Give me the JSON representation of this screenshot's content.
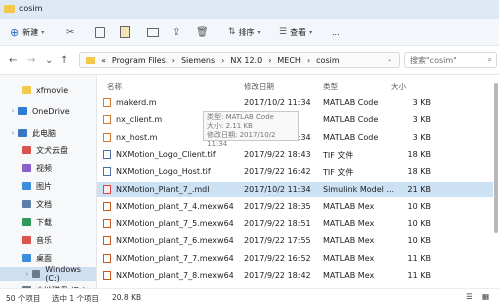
{
  "window": {
    "title": "cosim"
  },
  "toolbar": {
    "new_label": "新建",
    "sort_label": "排序",
    "view_label": "查看",
    "more": "..."
  },
  "address": {
    "back": "←",
    "forward": "→",
    "up": "↑",
    "refresh": "↻",
    "prefix": "«",
    "crumbs": [
      "Program Files",
      "Siemens",
      "NX 12.0",
      "MECH",
      "cosim"
    ],
    "sep": "›"
  },
  "search": {
    "placeholder": "搜索\"cosim\""
  },
  "sidebar": {
    "items": [
      {
        "label": "xfmovie",
        "color": "#f2c94c"
      },
      {
        "label": "OneDrive",
        "color": "#2d7cd6"
      },
      {
        "label": "此电脑",
        "color": "#3a77c2"
      },
      {
        "label": "文犬云盘",
        "color": "#d9534f"
      },
      {
        "label": "视频",
        "color": "#8a5fc7"
      },
      {
        "label": "图片",
        "color": "#3b8fd9"
      },
      {
        "label": "文档",
        "color": "#5c7ea8"
      },
      {
        "label": "下载",
        "color": "#2d9a5a"
      },
      {
        "label": "音乐",
        "color": "#d9534f"
      },
      {
        "label": "桌面",
        "color": "#3b8fd9"
      },
      {
        "label": "Windows (C:)",
        "color": "#6c7a89"
      },
      {
        "label": "本地磁盘 (D:)",
        "color": "#6c7a89"
      }
    ]
  },
  "columns": {
    "name": "名称",
    "date": "修改日期",
    "type": "类型",
    "size": "大小"
  },
  "files": [
    {
      "name": "makerd.m",
      "date": "2017/10/2 11:34",
      "type": "MATLAB Code",
      "size": "3 KB",
      "kind": "m"
    },
    {
      "name": "nx_client.m",
      "date": "",
      "type": "MATLAB Code",
      "size": "3 KB",
      "kind": "m"
    },
    {
      "name": "nx_host.m",
      "date": "2017/10/2 11:34",
      "type": "MATLAB Code",
      "size": "3 KB",
      "kind": "m"
    },
    {
      "name": "NXMotion_Logo_Client.tif",
      "date": "2017/9/22 18:43",
      "type": "TIF 文件",
      "size": "18 KB",
      "kind": "t"
    },
    {
      "name": "NXMotion_Logo_Host.tif",
      "date": "2017/9/22 16:42",
      "type": "TIF 文件",
      "size": "18 KB",
      "kind": "t"
    },
    {
      "name": "NXMotion_Plant_7_.mdl",
      "date": "2017/10/2 11:34",
      "type": "Simulink Model ...",
      "size": "21 KB",
      "kind": "s"
    },
    {
      "name": "NXMotion_plant_7_4.mexw64",
      "date": "2017/9/22 18:35",
      "type": "MATLAB Mex",
      "size": "10 KB",
      "kind": "x"
    },
    {
      "name": "NXMotion_plant_7_5.mexw64",
      "date": "2017/9/22 18:51",
      "type": "MATLAB Mex",
      "size": "10 KB",
      "kind": "x"
    },
    {
      "name": "NXMotion_plant_7_6.mexw64",
      "date": "2017/9/22 17:55",
      "type": "MATLAB Mex",
      "size": "10 KB",
      "kind": "x"
    },
    {
      "name": "NXMotion_plant_7_7.mexw64",
      "date": "2017/9/22 16:52",
      "type": "MATLAB Mex",
      "size": "11 KB",
      "kind": "x"
    },
    {
      "name": "NXMotion_plant_7_8.mexw64",
      "date": "2017/9/22 18:42",
      "type": "MATLAB Mex",
      "size": "11 KB",
      "kind": "x"
    }
  ],
  "selected_index": 5,
  "tooltip": {
    "line1": "类型: MATLAB Code",
    "line2": "大小: 2.11 KB",
    "line3": "修改日期: 2017/10/2 11:34"
  },
  "status": {
    "count": "50 个项目",
    "selected": "选中 1 个项目",
    "size": "20.8 KB"
  }
}
